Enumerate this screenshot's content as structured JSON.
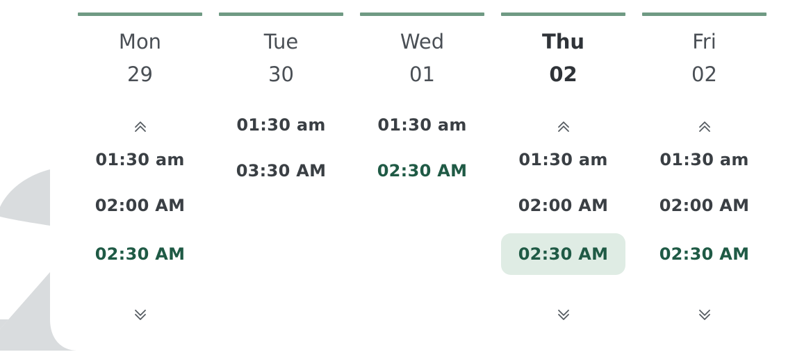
{
  "colors": {
    "accent_bar": "#6f9a83",
    "highlight_text": "#1f5a45",
    "selected_bg": "#dfece4",
    "text": "#3a3f44"
  },
  "days": [
    {
      "name": "Mon",
      "num": "29",
      "today": false,
      "has_chevrons": true,
      "slots": [
        {
          "label": "01:30 am",
          "state": "normal"
        },
        {
          "label": "02:00 AM",
          "state": "normal"
        },
        {
          "label": "02:30 AM",
          "state": "highlight"
        }
      ]
    },
    {
      "name": "Tue",
      "num": "30",
      "today": false,
      "has_chevrons": false,
      "slots": [
        {
          "label": "01:30 am",
          "state": "normal"
        },
        {
          "label": "03:30 AM",
          "state": "normal"
        }
      ]
    },
    {
      "name": "Wed",
      "num": "01",
      "today": false,
      "has_chevrons": false,
      "slots": [
        {
          "label": "01:30 am",
          "state": "normal"
        },
        {
          "label": "02:30 AM",
          "state": "highlight"
        }
      ]
    },
    {
      "name": "Thu",
      "num": "02",
      "today": true,
      "has_chevrons": true,
      "slots": [
        {
          "label": "01:30 am",
          "state": "normal"
        },
        {
          "label": "02:00 AM",
          "state": "normal"
        },
        {
          "label": "02:30 AM",
          "state": "selected"
        }
      ]
    },
    {
      "name": "Fri",
      "num": "02",
      "today": false,
      "has_chevrons": true,
      "slots": [
        {
          "label": "01:30 am",
          "state": "normal"
        },
        {
          "label": "02:00 AM",
          "state": "normal"
        },
        {
          "label": "02:30 AM",
          "state": "highlight"
        }
      ]
    }
  ]
}
